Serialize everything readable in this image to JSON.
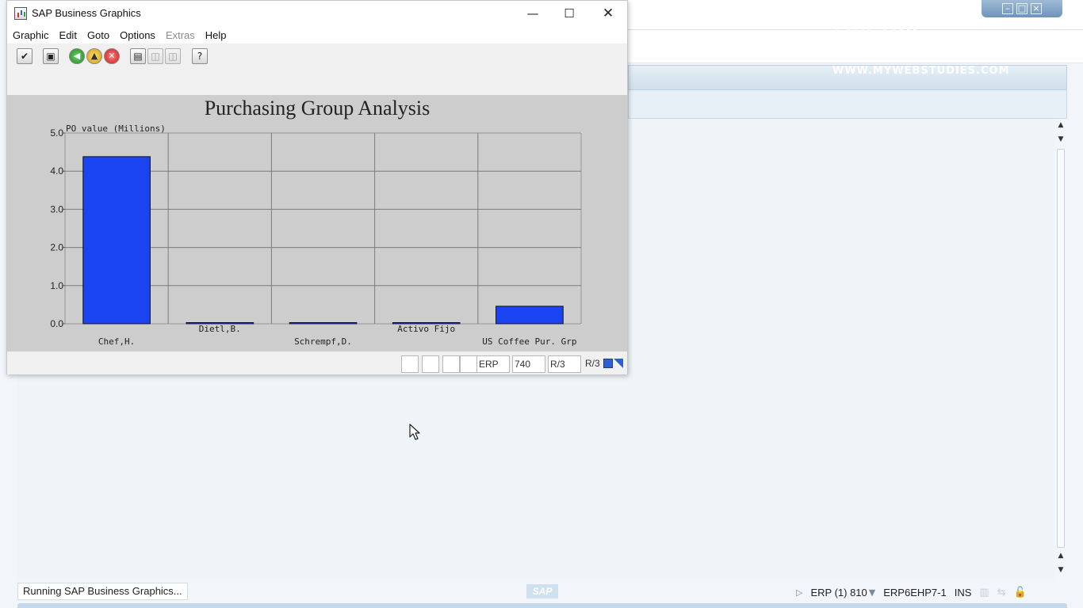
{
  "window": {
    "title": "SAP Business Graphics"
  },
  "menubar": {
    "items": [
      {
        "label": "Graphic",
        "enabled": true
      },
      {
        "label": "Edit",
        "enabled": true
      },
      {
        "label": "Goto",
        "enabled": true
      },
      {
        "label": "Options",
        "enabled": true
      },
      {
        "label": "Extras",
        "enabled": false
      },
      {
        "label": "Help",
        "enabled": true
      }
    ]
  },
  "toolbar": {
    "buttons": [
      "enter-icon",
      "save-icon",
      "back-icon",
      "exit-icon",
      "cancel-icon",
      "print-icon",
      "find-icon",
      "find-next-icon",
      "help-icon"
    ]
  },
  "chart_data": {
    "type": "bar",
    "title": "Purchasing Group Analysis",
    "ylabel": "PO value (Millions)",
    "xlabel": "",
    "categories": [
      "Chef,H.",
      "Dietl,B.",
      "Schrempf,D.",
      "Activo Fijo",
      "US Coffee Pur. Grp"
    ],
    "values": [
      4.38,
      0.03,
      0.03,
      0.03,
      0.46
    ],
    "ylim": [
      0,
      5
    ],
    "yticks": [
      "0.0",
      "1.0",
      "2.0",
      "3.0",
      "4.0",
      "5.0"
    ],
    "grid": true,
    "bar_color": "#1a44f2"
  },
  "footer": {
    "system": "ERP",
    "client": "740",
    "release": "R/3",
    "release_label": "R/3"
  },
  "background": {
    "watermark": [
      "FOR YOU",
      "MY WEB STUDIES",
      "WWW.MYWEBSTUDIES.COM"
    ]
  },
  "statusbar": {
    "message": "Running SAP Business Graphics...",
    "logo": "SAP",
    "system": "ERP (1) 810",
    "server": "ERP6EHP7-1",
    "mode": "INS"
  }
}
